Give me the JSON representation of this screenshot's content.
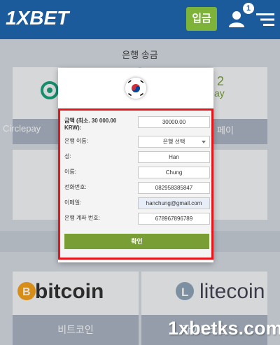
{
  "header": {
    "logo": "1XBET",
    "deposit_label": "입금",
    "notification_count": "1"
  },
  "page": {
    "title": "은행 송금"
  },
  "payment_methods": {
    "circlepay_label": "Circlepay",
    "pay2_label": "페이",
    "bitcoin_label": "bitcoin",
    "bitcoin_caption": "비트코인",
    "litecoin_label": "litecoin",
    "litecoin_caption": "라이트코인"
  },
  "form": {
    "amount_label": "금액 (최소. 30 000.00 KRW):",
    "amount_value": "30000.00",
    "bank_label": "은행 이름:",
    "bank_value": "은행 선택",
    "last_name_label": "성:",
    "last_name_value": "Han",
    "first_name_label": "이름:",
    "first_name_value": "Chung",
    "phone_label": "전화번호:",
    "phone_value": "082958385847",
    "email_label": "이메일:",
    "email_value": "hanchung@gmail.com",
    "account_label": "은행 계좌 번호:",
    "account_value": "678967896789",
    "confirm_label": "확인"
  },
  "watermark": "1xbetks.com",
  "colors": {
    "header": "#1b5a9b",
    "deposit": "#7eb33a",
    "highlight": "#e3161b",
    "confirm": "#7a9e36"
  }
}
